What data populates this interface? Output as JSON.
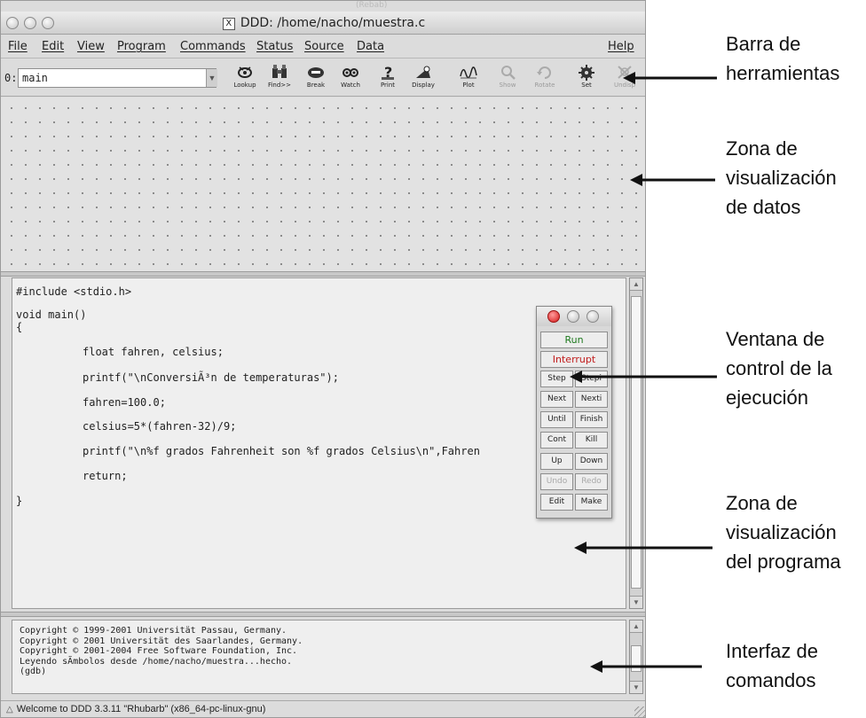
{
  "window": {
    "ghost_label": "(Rebab)",
    "title": "DDD: /home/nacho/muestra.c",
    "x_badge": "X"
  },
  "menubar": {
    "items": [
      "File",
      "Edit",
      "View",
      "Program",
      "Commands",
      "Status",
      "Source",
      "Data"
    ],
    "help": "Help"
  },
  "toolbar": {
    "arg_prefix": "0:",
    "arg_value": "main",
    "buttons": [
      "Lookup",
      "Find>>",
      "Break",
      "Watch",
      "Print",
      "Display",
      "Plot",
      "Show",
      "Rotate",
      "Set",
      "Undisp"
    ]
  },
  "source": {
    "lines": [
      "#include <stdio.h>",
      "void main()",
      "{",
      "float fahren, celsius;",
      "printf(\"\\nConversiÃ³n de temperaturas\");",
      "fahren=100.0;",
      "celsius=5*(fahren-32)/9;",
      "printf(\"\\n%f grados Fahrenheit son %f grados Celsius\\n\",Fahren",
      "return;",
      "}"
    ]
  },
  "control_window": {
    "run": "Run",
    "interrupt": "Interrupt",
    "step": "Step",
    "stepi": "Stepi",
    "next": "Next",
    "nexti": "Nexti",
    "until": "Until",
    "finish": "Finish",
    "cont": "Cont",
    "kill": "Kill",
    "up": "Up",
    "down": "Down",
    "undo": "Undo",
    "redo": "Redo",
    "edit": "Edit",
    "make": "Make"
  },
  "console": {
    "lines": [
      "Copyright © 1999-2001 Universität Passau, Germany.",
      "Copyright © 2001 Universität des Saarlandes, Germany.",
      "Copyright © 2001-2004 Free Software Foundation, Inc.",
      "Leyendo sÃ­mbolos desde /home/nacho/muestra...hecho.",
      "(gdb)"
    ]
  },
  "status": {
    "text": "Welcome to DDD 3.3.11 \"Rhubarb\" (x86_64-pc-linux-gnu)"
  },
  "annotations": {
    "toolbar": [
      "Barra de",
      "herramientas"
    ],
    "data": [
      "Zona de",
      "visualización",
      "de datos"
    ],
    "control": [
      "Ventana de",
      "control de la",
      "ejecución"
    ],
    "program": [
      "Zona de",
      "visualización",
      "del programa"
    ],
    "console": [
      "Interfaz de",
      "comandos"
    ]
  }
}
